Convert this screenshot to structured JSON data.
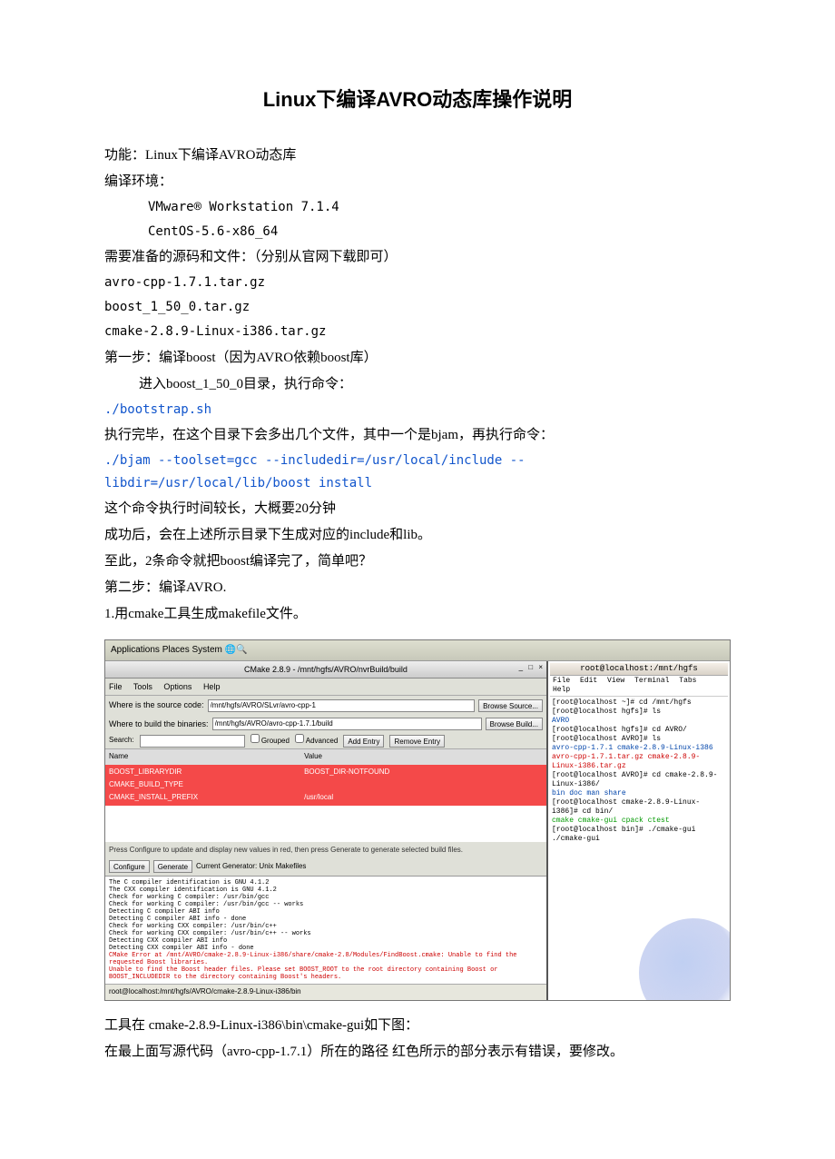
{
  "title": "Linux下编译AVRO动态库操作说明",
  "p1": "功能：Linux下编译AVRO动态库",
  "p2": "编译环境：",
  "env1": "VMware® Workstation 7.1.4",
  "env2": "CentOS-5.6-x86_64",
  "p3": "需要准备的源码和文件：（分别从官网下载即可）",
  "f1": "avro-cpp-1.7.1.tar.gz",
  "f2": "boost_1_50_0.tar.gz",
  "f3": "cmake-2.8.9-Linux-i386.tar.gz",
  "s1": "第一步：编译boost（因为AVRO依赖boost库）",
  "s1a": "进入boost_1_50_0目录，执行命令：",
  "cmd1": "./bootstrap.sh",
  "s1b": "执行完毕，在这个目录下会多出几个文件，其中一个是bjam，再执行命令：",
  "cmd2": "./bjam --toolset=gcc --includedir=/usr/local/include --libdir=/usr/local/lib/boost install",
  "s1c": "这个命令执行时间较长，大概要20分钟",
  "s1d": "成功后，会在上述所示目录下生成对应的include和lib。",
  "s1e": "至此，2条命令就把boost编译完了，简单吧？",
  "s2": "第二步：编译AVRO.",
  "s2a": "1.用cmake工具生成makefile文件。",
  "caption1": "工具在 cmake-2.8.9-Linux-i386\\bin\\cmake-gui如下图：",
  "caption2": "在最上面写源代码（avro-cpp-1.7.1）所在的路径 红色所示的部分表示有错误，要修改。",
  "shot": {
    "panel": "Applications   Places   System  🌐🔍",
    "cmake_title": "CMake 2.8.9 - /mnt/hgfs/AVRO/nvrBuild/build",
    "menu_file": "File",
    "menu_tools": "Tools",
    "menu_options": "Options",
    "menu_help": "Help",
    "lbl_src": "Where is the source code:",
    "val_src": "/mnt/hgfs/AVRO/SLvr/avro-cpp-1",
    "btn_browse_src": "Browse Source...",
    "lbl_bld": "Where to build the binaries:",
    "val_bld": "/mnt/hgfs/AVRO/avro-cpp-1.7.1/build",
    "btn_browse_bld": "Browse Build...",
    "lbl_search": "Search:",
    "opt_grouped": "Grouped",
    "opt_advanced": "Advanced",
    "btn_add": "Add Entry",
    "btn_remove": "Remove Entry",
    "col_name": "Name",
    "col_value": "Value",
    "rows": [
      {
        "name": "BOOST_LIBRARYDIR",
        "value": "BOOST_DIR-NOTFOUND"
      },
      {
        "name": "CMAKE_BUILD_TYPE",
        "value": ""
      },
      {
        "name": "CMAKE_INSTALL_PREFIX",
        "value": "/usr/local"
      }
    ],
    "hint": "Press Configure to update and display new values in red, then press Generate to generate selected build files.",
    "btn_configure": "Configure",
    "btn_generate": "Generate",
    "gen_label": "Current Generator: Unix Makefiles",
    "output_lines": [
      "The C compiler identification is GNU 4.1.2",
      "The CXX compiler identification is GNU 4.1.2",
      "Check for working C compiler: /usr/bin/gcc",
      "Check for working C compiler: /usr/bin/gcc -- works",
      "Detecting C compiler ABI info",
      "Detecting C compiler ABI info - done",
      "Check for working CXX compiler: /usr/bin/c++",
      "Check for working CXX compiler: /usr/bin/c++ -- works",
      "Detecting CXX compiler ABI info",
      "Detecting CXX compiler ABI info - done"
    ],
    "output_red": [
      "CMake Error at /mnt/AVRO/cmake-2.8.9-Linux-i386/share/cmake-2.8/Modules/FindBoost.cmake: Unable to find the requested Boost libraries.",
      "Unable to find the Boost header files. Please set BOOST_ROOT to the root directory containing Boost or BOOST_INCLUDEDIR to the directory containing Boost's headers."
    ],
    "status": "root@localhost:/mnt/hgfs/AVRO/cmake-2.8.9-Linux-i386/bin",
    "term_title": "root@localhost:/mnt/hgfs",
    "term_menu": [
      "File",
      "Edit",
      "View",
      "Terminal",
      "Tabs",
      "Help"
    ],
    "term_lines": [
      {
        "t": "[root@localhost ~]# cd /mnt/hgfs",
        "c": ""
      },
      {
        "t": "[root@localhost hgfs]# ls",
        "c": ""
      },
      {
        "t": "AVRO",
        "c": "b"
      },
      {
        "t": "[root@localhost hgfs]# cd AVRO/",
        "c": ""
      },
      {
        "t": "[root@localhost AVRO]# ls",
        "c": ""
      },
      {
        "t": "avro-cpp-1.7.1         cmake-2.8.9-Linux-i386",
        "c": "b"
      },
      {
        "t": "avro-cpp-1.7.1.tar.gz  cmake-2.8.9-Linux-i386.tar.gz",
        "c": "r"
      },
      {
        "t": "[root@localhost AVRO]# cd cmake-2.8.9-Linux-i386/",
        "c": ""
      },
      {
        "t": "bin  doc  man  share",
        "c": "b"
      },
      {
        "t": "[root@localhost cmake-2.8.9-Linux-i386]# cd bin/",
        "c": ""
      },
      {
        "t": "cmake  cmake-gui  cpack  ctest",
        "c": "g"
      },
      {
        "t": "[root@localhost bin]# ./cmake-gui",
        "c": ""
      },
      {
        "t": "./cmake-gui",
        "c": ""
      }
    ]
  }
}
